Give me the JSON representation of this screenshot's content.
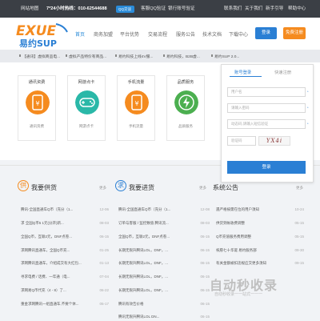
{
  "topbar": {
    "site_map": "网站地图",
    "hotline": "7*24小时热线：010-62544688",
    "qq": "QQ交谈",
    "qq_auth": "客服QQ验证",
    "bank_auth": "银行账号验证",
    "contact": "联系我们",
    "about": "关于我们",
    "guide": "新手引导",
    "help": "帮助中心"
  },
  "logo": {
    "text": "易约SUP"
  },
  "nav": [
    "首页",
    "商务加盟",
    "平台优势",
    "交易流程",
    "服务公告",
    "技术文档",
    "下载中心"
  ],
  "header": {
    "login": "登录",
    "register": "免费注册"
  },
  "ticker": [
    "【通讯】虚拟商品电...",
    "虚拟产品特价有商品...",
    "易约科技上线4V服...",
    "易约科技，B2B虚...",
    "易约SUP 2.0..."
  ],
  "cards": [
    {
      "title": "通讯资费",
      "sub": "通讯资费",
      "color": "#f58b1f",
      "icon": "phone-yen-icon"
    },
    {
      "title": "网游点卡",
      "sub": "网游点卡",
      "color": "#2ab8a8",
      "icon": "gamepad-icon"
    },
    {
      "title": "手机流量",
      "sub": "手机流量",
      "color": "#f58b1f",
      "icon": "phone-yen-icon"
    },
    {
      "title": "品质服务",
      "sub": "品质服务",
      "color": "#4caf50",
      "icon": "lightning-icon"
    }
  ],
  "login_box": {
    "tab_account": "账号登录",
    "tab_quick": "快速注册",
    "user_placeholder": "用户名",
    "pwd_placeholder": "请输入密码",
    "code_placeholder": "动态码,请输入短信验证",
    "captcha_placeholder": "验证码",
    "captcha_text": "YX4i",
    "button": "登录"
  },
  "supply": {
    "badge": "供",
    "title": "我要供货",
    "more": "更多",
    "rows": [
      {
        "t": "腾讯-全国直通车Q币（充分（1...",
        "d": "12-06"
      },
      {
        "t": "求 全国Q币5 1元(分开)新...",
        "d": "08-03"
      },
      {
        "t": "全国Q币，互联2元，DNF点卷...",
        "d": "06-15"
      },
      {
        "t": "求网腾讯直通车，全国Q币充...",
        "d": "01-25"
      },
      {
        "t": "求网腾讯直通车，介绍成交有大红包...",
        "d": "01-13"
      },
      {
        "t": "寻求电费 / 话费、一年通（电...",
        "d": "07-04"
      },
      {
        "t": "求网易Q币代充（4 - 8）了...",
        "d": "06-22"
      },
      {
        "t": "重金求网腾讯一组直通车,不要个体...",
        "d": "05-17"
      }
    ]
  },
  "purchase": {
    "badge": "求",
    "title": "我要进货",
    "more": "更多",
    "rows": [
      {
        "t": "腾讯-全国直通车Q币（充分（1...",
        "d": "12-08"
      },
      {
        "t": "订单与客服 / 监控数值 腾讯流...",
        "d": "08-03"
      },
      {
        "t": "全国Q币，互联2元，DNF点卷...",
        "d": "06-15"
      },
      {
        "t": "长期无限升腾讯LOL，DNF，...",
        "d": "06-15"
      },
      {
        "t": "长期无限升腾讯LOL，DNF，...",
        "d": "06-15"
      },
      {
        "t": "长期无限升腾讯LOL，DNF，...",
        "d": "06-15"
      },
      {
        "t": "长期无限升腾讯LOL，DNF，...",
        "d": "06-15"
      },
      {
        "t": "腾讯有效告价格",
        "d": "06-15"
      },
      {
        "t": "腾讯无限升腾讯LOL DN...",
        "d": "06-15"
      }
    ]
  },
  "notice": {
    "title": "系统公告",
    "more": "更多",
    "rows": [
      {
        "t": "遇严格按需在位的用户须知",
        "d": "10-24"
      },
      {
        "t": "供货到帐收费调整",
        "d": "05-15"
      },
      {
        "t": "Q币充值服务费用调整",
        "d": "05-15"
      },
      {
        "t": "祝愿七十华诞 易约服务部",
        "d": "09-30"
      },
      {
        "t": "有关金额被扣违规应交更多须知",
        "d": "09-15"
      }
    ]
  },
  "watermark": {
    "big": "自动秒收录",
    "small": "自动秒收录一一站式一一一"
  }
}
